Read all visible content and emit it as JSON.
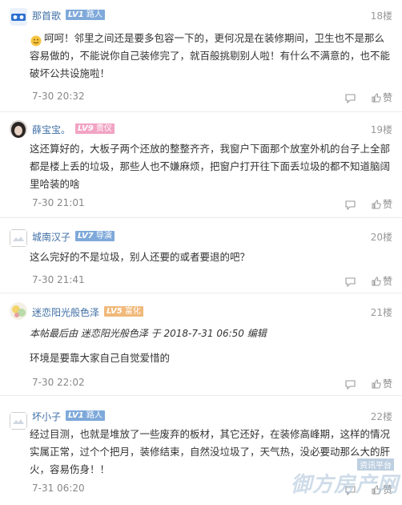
{
  "posts": [
    {
      "username": "那首歌",
      "level": "LV1",
      "badge": "路人",
      "floor": "18楼",
      "text": "呵呵！邻里之间还是要多包容一下的，更何况是在装修期间，卫生也不是那么容易做的，不能说你自己装修完了，就百般挑剔别人啦！有什么不满意的，也不能破坏公共设施啦！",
      "time": "7-30 20:32",
      "like": "赞"
    },
    {
      "username": "薛宝宝。",
      "level": "LV9",
      "badge": "贵仪",
      "floor": "19楼",
      "text": "这还算好的，大板子两个还放的整整齐齐，我窗户下面那个放室外机的台子上全部都是楼上丢的垃圾，那些人也不嫌麻烦，把窗户打开往下面丢垃圾的都不知道脑阔里哈装的啥",
      "time": "7-30 21:01",
      "like": "赞"
    },
    {
      "username": "城南汉子",
      "level": "LV7",
      "badge": "导演",
      "floor": "20楼",
      "text": "这么完好的不是垃圾，别人还要的或者要退的吧？",
      "time": "7-30 21:41",
      "like": "赞"
    },
    {
      "username": "迷恋阳光般色泽",
      "level": "LV5",
      "badge": "富化",
      "floor": "21楼",
      "edit_note": "本帖最后由 迷恋阳光般色泽 于 2018-7-31 06:50 编辑",
      "text": "环境是要靠大家自己自觉爱惜的",
      "time": "7-30 22:02",
      "like": "赞"
    },
    {
      "username": "坏小子",
      "level": "LV1",
      "badge": "路人",
      "floor": "22楼",
      "text": "经过目测，也就是堆放了一些废弃的板材，其它还好，在装修高峰期，这样的情况实属正常，过个个把月，装修结束，自然没垃圾了，天气热，没必要动那么大的肝火，容易伤身！！",
      "time": "7-31 06:20",
      "like": "赞"
    }
  ],
  "watermark": {
    "top": "资讯平台",
    "main": "御方房产网"
  },
  "colors": {
    "username": "#3f6fa5",
    "level_blue": "#7fa9da",
    "level_pink": "#f2a4c4",
    "level_orange": "#f1b97a"
  },
  "icons": {
    "reply": "reply-icon",
    "like": "thumbs-up-icon"
  }
}
